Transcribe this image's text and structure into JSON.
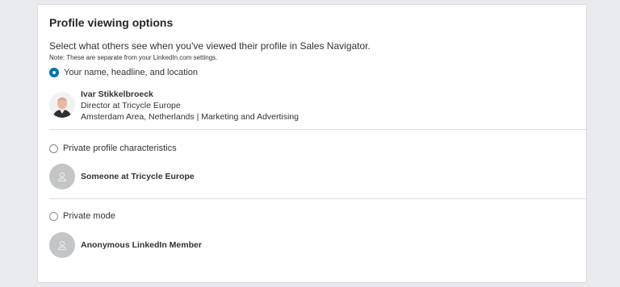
{
  "section": {
    "title": "Profile viewing options",
    "description": "Select what others see when you've viewed their profile in Sales Navigator.",
    "note": "Note: These are separate from your LinkedIn.com settings."
  },
  "options": [
    {
      "label": "Your name, headline, and location",
      "selected": true,
      "preview": {
        "name": "Ivar Stikkelbroeck",
        "headline": "Director at Tricycle Europe",
        "location": "Amsterdam Area, Netherlands | Marketing and Advertising",
        "avatar_icon": "profile-photo"
      }
    },
    {
      "label": "Private profile characteristics",
      "selected": false,
      "preview": {
        "name": "Someone at Tricycle Europe",
        "avatar_icon": "ghost-person-icon"
      }
    },
    {
      "label": "Private mode",
      "selected": false,
      "preview": {
        "name": "Anonymous LinkedIn Member",
        "avatar_icon": "ghost-person-icon"
      }
    }
  ],
  "colors": {
    "accent": "#0073b1",
    "page_background": "#e9ebee",
    "card_background": "#ffffff",
    "ghost_avatar": "#c3c5c7"
  }
}
